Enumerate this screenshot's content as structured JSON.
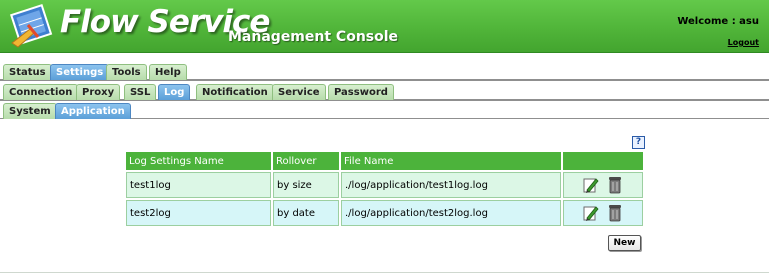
{
  "header": {
    "brand": "Flow Service",
    "subtitle": "Management Console",
    "welcome": "Welcome : asu",
    "logout": "Logout"
  },
  "tabs_main": [
    {
      "label": "Status",
      "active": false
    },
    {
      "label": "Settings",
      "active": true
    },
    {
      "label": "Tools",
      "active": false
    },
    {
      "label": "Help",
      "active": false
    }
  ],
  "tabs_settings": [
    {
      "label": "Connection",
      "active": false
    },
    {
      "label": "Proxy",
      "active": false
    },
    {
      "label": "SSL",
      "active": false
    },
    {
      "label": "Log",
      "active": true
    },
    {
      "label": "Notification",
      "active": false
    },
    {
      "label": "Service",
      "active": false
    },
    {
      "label": "Password",
      "active": false
    }
  ],
  "tabs_log": [
    {
      "label": "System",
      "active": false
    },
    {
      "label": "Application",
      "active": true
    }
  ],
  "help": "?",
  "table": {
    "headers": [
      "Log Settings Name",
      "Rollover",
      "File Name",
      ""
    ],
    "rows": [
      {
        "name": "test1log",
        "rollover": "by size",
        "file": "./log/application/test1log.log"
      },
      {
        "name": "test2log",
        "rollover": "by date",
        "file": "./log/application/test2log.log"
      }
    ]
  },
  "buttons": {
    "new": "New"
  },
  "colors": {
    "header_green": "#4fb338",
    "tab_active": "#5b9fd8",
    "table_header": "#4cb33b",
    "row1_bg": "#dcf7e6",
    "row2_bg": "#d6f6f8"
  },
  "icons": {
    "edit": "pencil-icon",
    "delete": "trash-icon",
    "logo": "flow-logo-icon"
  }
}
